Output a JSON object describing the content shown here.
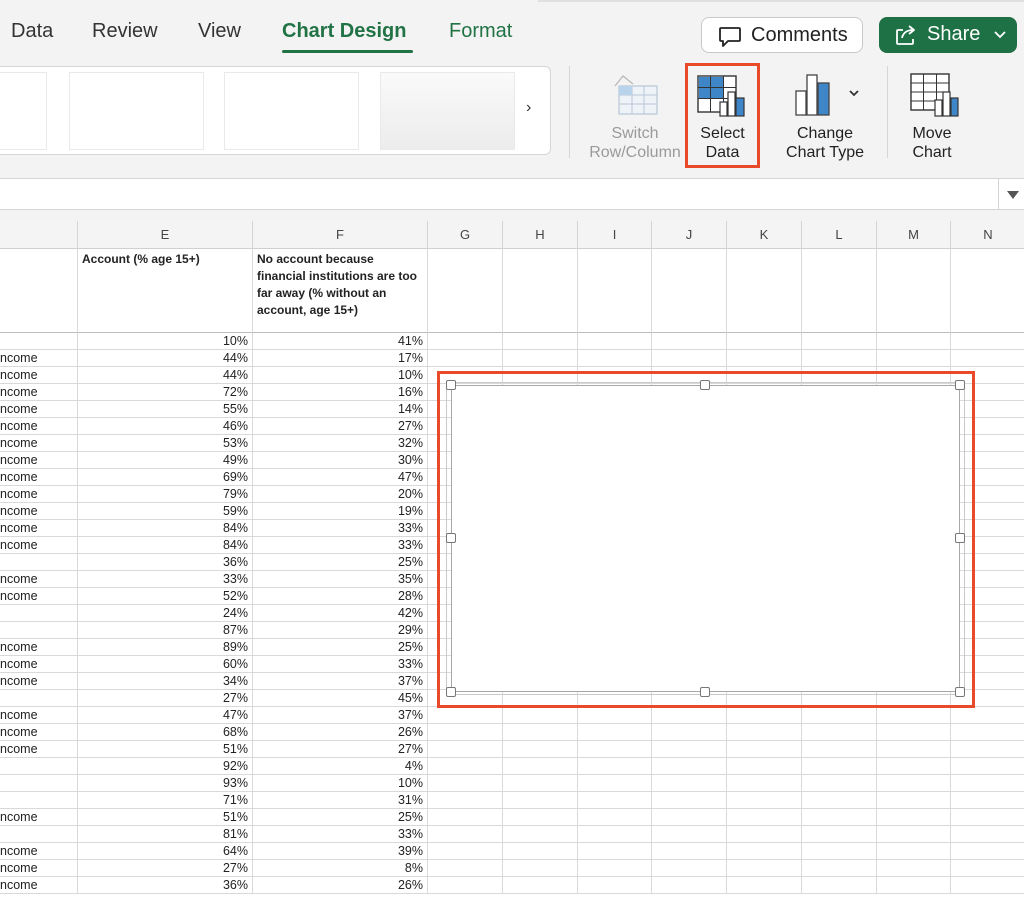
{
  "ribbon": {
    "tabs": [
      {
        "label": "Data"
      },
      {
        "label": "Review"
      },
      {
        "label": "View"
      },
      {
        "label": "Chart Design"
      },
      {
        "label": "Format"
      }
    ],
    "active_tab": "Chart Design",
    "comments_label": "Comments",
    "share_label": "Share",
    "buttons": {
      "switch_row_column": {
        "line1": "Switch",
        "line2": "Row/Column"
      },
      "select_data": {
        "line1": "Select",
        "line2": "Data"
      },
      "change_chart_type": {
        "line1": "Change",
        "line2": "Chart Type"
      },
      "move_chart": {
        "line1": "Move",
        "line2": "Chart"
      }
    }
  },
  "sheet": {
    "columns": [
      "E",
      "F",
      "G",
      "H",
      "I",
      "J",
      "K",
      "L",
      "M",
      "N"
    ],
    "header_E": "Account (% age 15+)",
    "header_F": "No account because financial institutions are too far away (% without an account, age 15+)",
    "rows": [
      {
        "d": "",
        "e": "10%",
        "f": "41%"
      },
      {
        "d": "ncome",
        "e": "44%",
        "f": "17%"
      },
      {
        "d": "ncome",
        "e": "44%",
        "f": "10%"
      },
      {
        "d": "ncome",
        "e": "72%",
        "f": "16%"
      },
      {
        "d": "ncome",
        "e": "55%",
        "f": "14%"
      },
      {
        "d": "ncome",
        "e": "46%",
        "f": "27%"
      },
      {
        "d": "ncome",
        "e": "53%",
        "f": "32%"
      },
      {
        "d": "ncome",
        "e": "49%",
        "f": "30%"
      },
      {
        "d": "ncome",
        "e": "69%",
        "f": "47%"
      },
      {
        "d": "ncome",
        "e": "79%",
        "f": "20%"
      },
      {
        "d": "ncome",
        "e": "59%",
        "f": "19%"
      },
      {
        "d": "ncome",
        "e": "84%",
        "f": "33%"
      },
      {
        "d": "ncome",
        "e": "84%",
        "f": "33%"
      },
      {
        "d": "",
        "e": "36%",
        "f": "25%"
      },
      {
        "d": "ncome",
        "e": "33%",
        "f": "35%"
      },
      {
        "d": "ncome",
        "e": "52%",
        "f": "28%"
      },
      {
        "d": "",
        "e": "24%",
        "f": "42%"
      },
      {
        "d": "",
        "e": "87%",
        "f": "29%"
      },
      {
        "d": "ncome",
        "e": "89%",
        "f": "25%"
      },
      {
        "d": "ncome",
        "e": "60%",
        "f": "33%"
      },
      {
        "d": "ncome",
        "e": "34%",
        "f": "37%"
      },
      {
        "d": "",
        "e": "27%",
        "f": "45%"
      },
      {
        "d": "ncome",
        "e": "47%",
        "f": "37%"
      },
      {
        "d": "ncome",
        "e": "68%",
        "f": "26%"
      },
      {
        "d": "ncome",
        "e": "51%",
        "f": "27%"
      },
      {
        "d": "",
        "e": "92%",
        "f": "4%"
      },
      {
        "d": "",
        "e": "93%",
        "f": "10%"
      },
      {
        "d": "",
        "e": "71%",
        "f": "31%"
      },
      {
        "d": "ncome",
        "e": "51%",
        "f": "25%"
      },
      {
        "d": "",
        "e": "81%",
        "f": "33%"
      },
      {
        "d": "ncome",
        "e": "64%",
        "f": "39%"
      },
      {
        "d": "ncome",
        "e": "27%",
        "f": "8%"
      },
      {
        "d": "ncome",
        "e": "36%",
        "f": "26%"
      }
    ]
  }
}
